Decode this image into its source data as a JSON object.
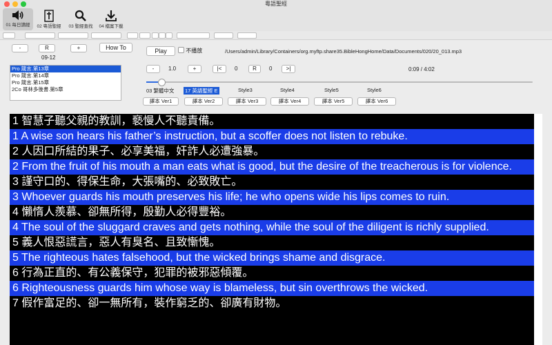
{
  "window": {
    "title": "粵語聖經"
  },
  "toolbar": {
    "items": [
      {
        "label": "01 每日讀經"
      },
      {
        "label": "02 粵語聖經"
      },
      {
        "label": "03 聖經查找"
      },
      {
        "label": "04 檔案下載"
      }
    ]
  },
  "controls": {
    "minus": "-",
    "reset": "R",
    "plus": "+",
    "howto": "How To",
    "date": "09-12",
    "play": "Play",
    "no_play": "不播放",
    "path": "/Users/admin/Library/Containers/org.myftp.share35.BibleHongHome/Data/Documents/020/20_013.mp3",
    "speed_minus": "-",
    "speed_value": "1.0",
    "speed_plus": "+",
    "loop_start": "|<",
    "loop_start_value": "0",
    "loop_reset": "R",
    "loop_end_value": "0",
    "loop_end": ">|",
    "time": "0:09 / 4:02",
    "progress": 0.037
  },
  "chapters": [
    {
      "label": "Pro 箴言.第13章",
      "selected": true
    },
    {
      "label": "Pro 箴言.第14章",
      "selected": false
    },
    {
      "label": "Pro 箴言.第15章",
      "selected": false
    },
    {
      "label": "2Co 哥林多後書.第5章",
      "selected": false
    }
  ],
  "styles": [
    {
      "label": "03 繁體中文",
      "selected": false
    },
    {
      "label": "17 英語聖經 E",
      "selected": true
    },
    {
      "label": "Style3",
      "selected": false
    },
    {
      "label": "Style4",
      "selected": false
    },
    {
      "label": "Style5",
      "selected": false
    },
    {
      "label": "Style6",
      "selected": false
    }
  ],
  "versions": [
    "譯本 Ver1",
    "譯本 Ver2",
    "譯本 Ver3",
    "譯本 Ver4",
    "譯本 Ver5",
    "譯本 Ver6"
  ],
  "verses": [
    {
      "lang": "zh",
      "text": "1 智慧子聽父親的教訓，褻慢人不聽責備。"
    },
    {
      "lang": "en",
      "text": "1 A wise son hears his father’s instruction, but a scoffer does not listen to rebuke."
    },
    {
      "lang": "zh",
      "text": "2 人因口所結的果子、必享美福，奸詐人必遭強暴。"
    },
    {
      "lang": "en",
      "text": "2 From the fruit of his mouth a man eats what is good, but the desire of the treacherous is for violence."
    },
    {
      "lang": "zh",
      "text": "3 謹守口的、得保生命，大張嘴的、必致敗亡。"
    },
    {
      "lang": "en",
      "text": "3 Whoever guards his mouth preserves his life; he who opens wide his lips comes to ruin."
    },
    {
      "lang": "zh",
      "text": "4 懶惰人羨慕、卻無所得，殷勤人必得豐裕。"
    },
    {
      "lang": "en",
      "text": "4 The soul of the sluggard craves and gets nothing, while the soul of the diligent is richly supplied."
    },
    {
      "lang": "zh",
      "text": "5 義人恨惡謊言，惡人有臭名、且致慚愧。"
    },
    {
      "lang": "en",
      "text": "5 The righteous hates falsehood, but the wicked brings shame and disgrace."
    },
    {
      "lang": "zh",
      "text": "6 行為正直的、有公義保守，犯罪的被邪惡傾覆。"
    },
    {
      "lang": "en",
      "text": "6 Righteousness guards him whose way is blameless, but sin overthrows the wicked."
    },
    {
      "lang": "zh",
      "text": "7 假作富足的、卻一無所有，裝作窮乏的、卻廣有財物。"
    }
  ],
  "colors": {
    "english_row": "#1a3de8",
    "chinese_row": "#000000",
    "selection": "#1b5ad6"
  }
}
